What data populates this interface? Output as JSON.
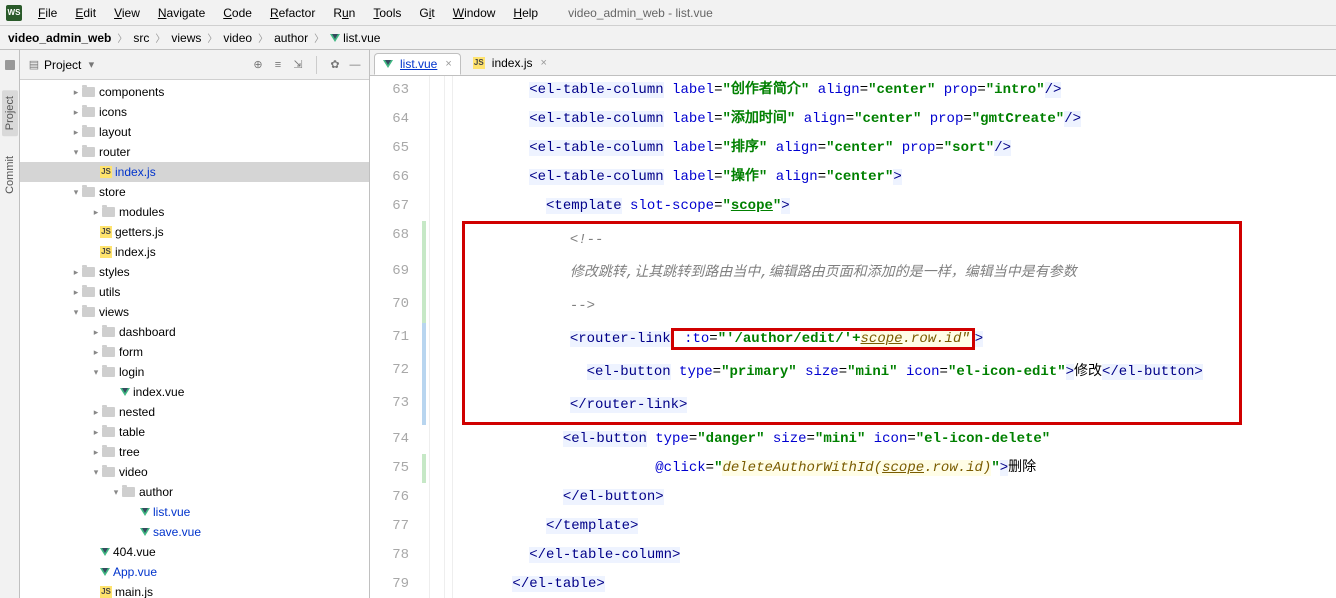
{
  "window_title": "video_admin_web - list.vue",
  "menus": [
    "File",
    "Edit",
    "View",
    "Navigate",
    "Code",
    "Refactor",
    "Run",
    "Tools",
    "Git",
    "Window",
    "Help"
  ],
  "breadcrumbs": [
    "video_admin_web",
    "src",
    "views",
    "video",
    "author",
    "list.vue"
  ],
  "sidebar": {
    "title": "Project",
    "tree": {
      "components": "components",
      "icons": "icons",
      "layout": "layout",
      "router": "router",
      "router_index": "index.js",
      "store": "store",
      "modules": "modules",
      "getters": "getters.js",
      "store_index": "index.js",
      "styles": "styles",
      "utils": "utils",
      "views": "views",
      "dashboard": "dashboard",
      "form": "form",
      "login": "login",
      "login_index": "index.vue",
      "nested": "nested",
      "table": "table",
      "tree": "tree",
      "video": "video",
      "author": "author",
      "list_vue": "list.vue",
      "save_vue": "save.vue",
      "f404": "404.vue",
      "app_vue": "App.vue",
      "main_js": "main.js"
    }
  },
  "rail": {
    "project": "Project",
    "commit": "Commit"
  },
  "tabs": {
    "list_vue": "list.vue",
    "index_js": "index.js"
  },
  "code": {
    "l63_lbl": "创作者简介",
    "l63_prop": "intro",
    "l64_lbl": "添加时间",
    "l64_prop": "gmtCreate",
    "l65_lbl": "排序",
    "l65_prop": "sort",
    "l66_lbl": "操作",
    "align": "center",
    "scope": "scope",
    "cm_open": "<!--",
    "comment": "修改跳转,让其跳转到路由当中,编辑路由页面和添加的是一样，编辑当中是有参数",
    "cm_close": "-->",
    "l71_to": "\"'/author/edit/'+",
    "l71_sid": "scope",
    "l71_rest": ".row.id\"",
    "l72_type": "primary",
    "l72_size": "mini",
    "l72_icon": "el-icon-edit",
    "l72_text": "修改",
    "l74_type": "danger",
    "l74_size": "mini",
    "l74_icon": "el-icon-delete",
    "l75_click_pre": "deleteAuthorWithId(",
    "l75_scope": "scope",
    "l75_click_post": ".row.id)",
    "l75_text": "删除",
    "line_numbers": [
      "63",
      "64",
      "65",
      "66",
      "67",
      "68",
      "69",
      "70",
      "71",
      "72",
      "73",
      "74",
      "75",
      "76",
      "77",
      "78",
      "79"
    ]
  }
}
